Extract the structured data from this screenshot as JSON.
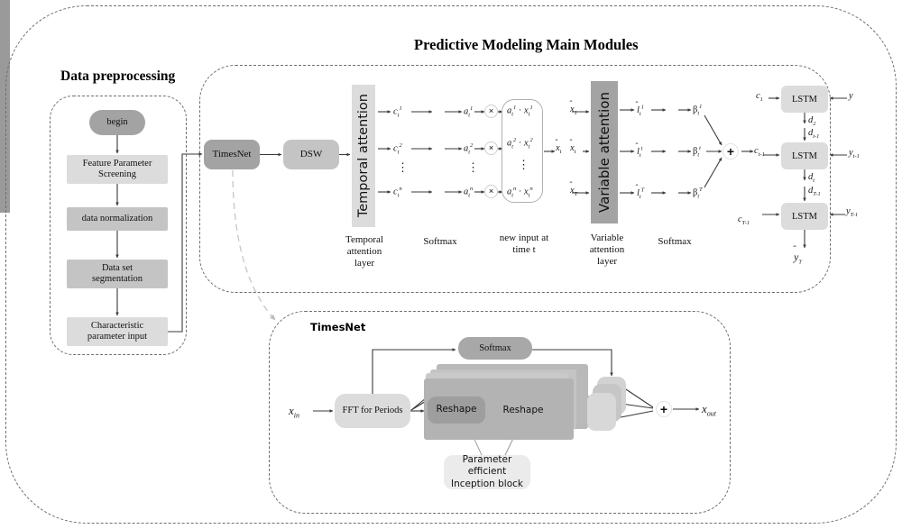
{
  "figure": {
    "type": "architecture-diagram",
    "outer_title": "Predictive Modeling Main Modules",
    "preprocessing_title": "Data preprocessing",
    "timesnet_title": "TimesNet"
  },
  "colors": {
    "dark_box": "#a3a3a3",
    "mid_box": "#c4c4c4",
    "light_box": "#dcdcdc",
    "softmax_bar": "#9a9a9a",
    "dashed_border": "#6f6f6f",
    "arrow": "#3a3a3a",
    "faint_arrow": "#c0c0c0",
    "text": "#111111"
  },
  "preprocessing": {
    "title": "Data preprocessing",
    "nodes": [
      {
        "id": "begin",
        "label": "begin",
        "shape": "pill",
        "fill": "dark"
      },
      {
        "id": "feature-parameter-screening",
        "label": "Feature Parameter\nScreening",
        "shape": "rect",
        "fill": "light"
      },
      {
        "id": "data-normalization",
        "label": "data normalization",
        "shape": "rect",
        "fill": "mid"
      },
      {
        "id": "data-set-segmentation",
        "label": "Data set\nsegmentation",
        "shape": "rect",
        "fill": "mid"
      },
      {
        "id": "characteristic-parameter-input",
        "label": "Characteristic\nparameter input",
        "shape": "rect",
        "fill": "light"
      }
    ]
  },
  "main_modules": {
    "title": "Predictive Modeling Main Modules",
    "timesnet_label": "TimesNet",
    "dsw_label": "DSW",
    "temporal_attention_bar": "Temporal attention",
    "variable_attention_bar": "Variable attention",
    "captions": [
      {
        "id": "temporal-attention-layer",
        "text": "Temporal\nattention\nlayer"
      },
      {
        "id": "softmax-1",
        "text": "Softmax"
      },
      {
        "id": "new-input-at-time-t",
        "text": "new input at\ntime t"
      },
      {
        "id": "variable-attention-layer",
        "text": "Variable\nattention\nlayer"
      },
      {
        "id": "softmax-2",
        "text": "Softmax"
      }
    ],
    "temporal_rows": [
      {
        "c": "c",
        "c_sub": "t",
        "c_sup": "1",
        "a": "a",
        "a_sub": "t",
        "a_sup": "1",
        "prod": "a",
        "prod_sup": "1",
        "prod_x": "x",
        "prod_x_sup": "1",
        "mul": "×"
      },
      {
        "c": "c",
        "c_sub": "t",
        "c_sup": "2",
        "a": "a",
        "a_sub": "t",
        "a_sup": "2",
        "prod": "a",
        "prod_sup": "2",
        "prod_x": "x",
        "prod_x_sup": "2",
        "mul": "×"
      },
      {
        "c": "c",
        "c_sub": "t",
        "c_sup": "n",
        "a": "a",
        "a_sub": "t",
        "a_sup": "n",
        "prod": "a",
        "prod_sup": "n",
        "prod_x": "x",
        "prod_x_sup": "n",
        "mul": "×"
      }
    ],
    "xhat_out": {
      "base": "x",
      "sub": "t"
    },
    "variable_rows": [
      {
        "xhat": "x",
        "xhat_sub": "1",
        "l": "l",
        "l_sub": "t",
        "l_sup": "1",
        "beta": "β",
        "beta_sub": "t",
        "beta_sup": "1"
      },
      {
        "xhat": "x",
        "xhat_sub": "t",
        "l": "l",
        "l_sub": "t",
        "l_sup": "t",
        "beta": "β",
        "beta_sub": "t",
        "beta_sup": "t"
      },
      {
        "xhat": "x",
        "xhat_sub": "T",
        "l": "l",
        "l_sub": "t",
        "l_sup": "T",
        "beta": "β",
        "beta_sub": "t",
        "beta_sup": "T"
      }
    ],
    "sum_symbol": "+",
    "context_out": {
      "base": "c",
      "sub": "t-1"
    },
    "dots": "⋮"
  },
  "lstm_chain": {
    "cells": [
      {
        "id": "lstm-1",
        "label": "LSTM",
        "c_in": "c",
        "c_in_sub": "1",
        "y_in": "y",
        "y_in_sub": "",
        "out_down": "d",
        "out_down_sub": "2"
      },
      {
        "id": "lstm-2",
        "label": "LSTM",
        "c_in": "c",
        "c_in_sub": "t-1",
        "y_in": "y",
        "y_in_sub": "t-1",
        "out_down": "d",
        "out_down_sub": "t"
      },
      {
        "id": "lstm-3",
        "label": "LSTM",
        "c_in": "c",
        "c_in_sub": "T-1",
        "y_in": "y",
        "y_in_sub": "T-1",
        "out_down": "",
        "out_down_sub": ""
      }
    ],
    "edge_labels": [
      {
        "id": "d-2",
        "base": "d",
        "sub": "2"
      },
      {
        "id": "d-t-1",
        "base": "d",
        "sub": "t-1"
      },
      {
        "id": "d-t",
        "base": "d",
        "sub": "t"
      },
      {
        "id": "d-T-1",
        "base": "d",
        "sub": "T-1"
      }
    ],
    "y_out": "y",
    "final_output": {
      "base": "y",
      "sub": "T",
      "hat": true
    }
  },
  "timesnet": {
    "title": "TimesNet",
    "input": {
      "base": "x",
      "sub": "in"
    },
    "output": {
      "base": "x",
      "sub": "out"
    },
    "fft_label": "FFT for Periods",
    "softmax_label": "Softmax",
    "reshape_label_1": "Reshape",
    "reshape_label_2": "Reshape",
    "inception_label": "Parameter efficient\nInception block",
    "plus_symbol": "+"
  }
}
